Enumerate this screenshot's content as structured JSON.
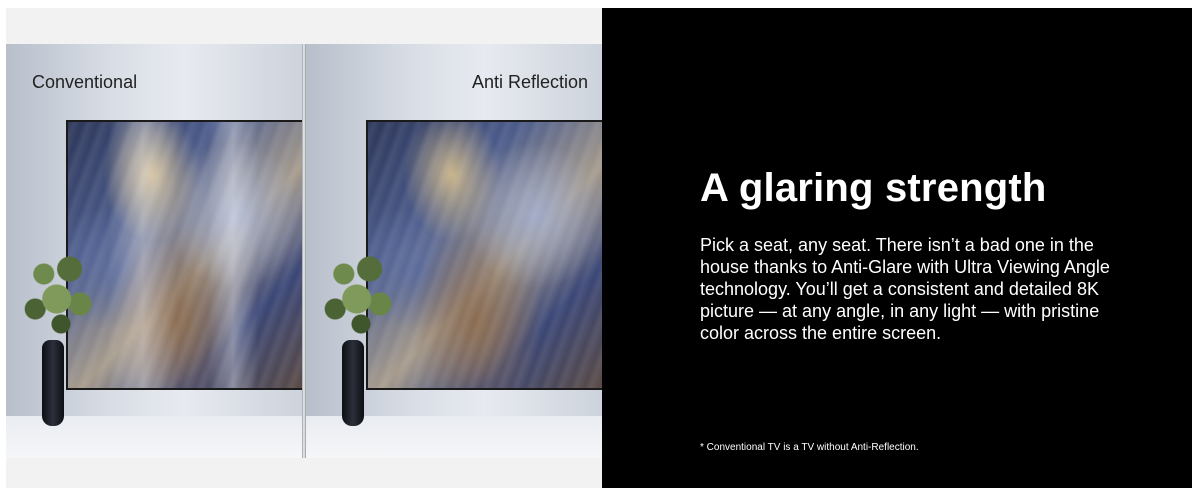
{
  "comparison": {
    "left_label": "Conventional",
    "right_label": "Anti Reflection"
  },
  "content": {
    "headline": "A glaring strength",
    "body": "Pick a seat, any seat. There isn’t a bad one in the house thanks to Anti-Glare with Ultra Viewing Angle technology. You’ll get a consistent and detailed 8K picture — at any angle, in any light — with pristine color across the entire screen.",
    "footnote": "* Conventional TV is a TV without Anti-Reflection."
  },
  "colors": {
    "info_background": "#000000",
    "text": "#ffffff",
    "label_text": "#222222"
  }
}
